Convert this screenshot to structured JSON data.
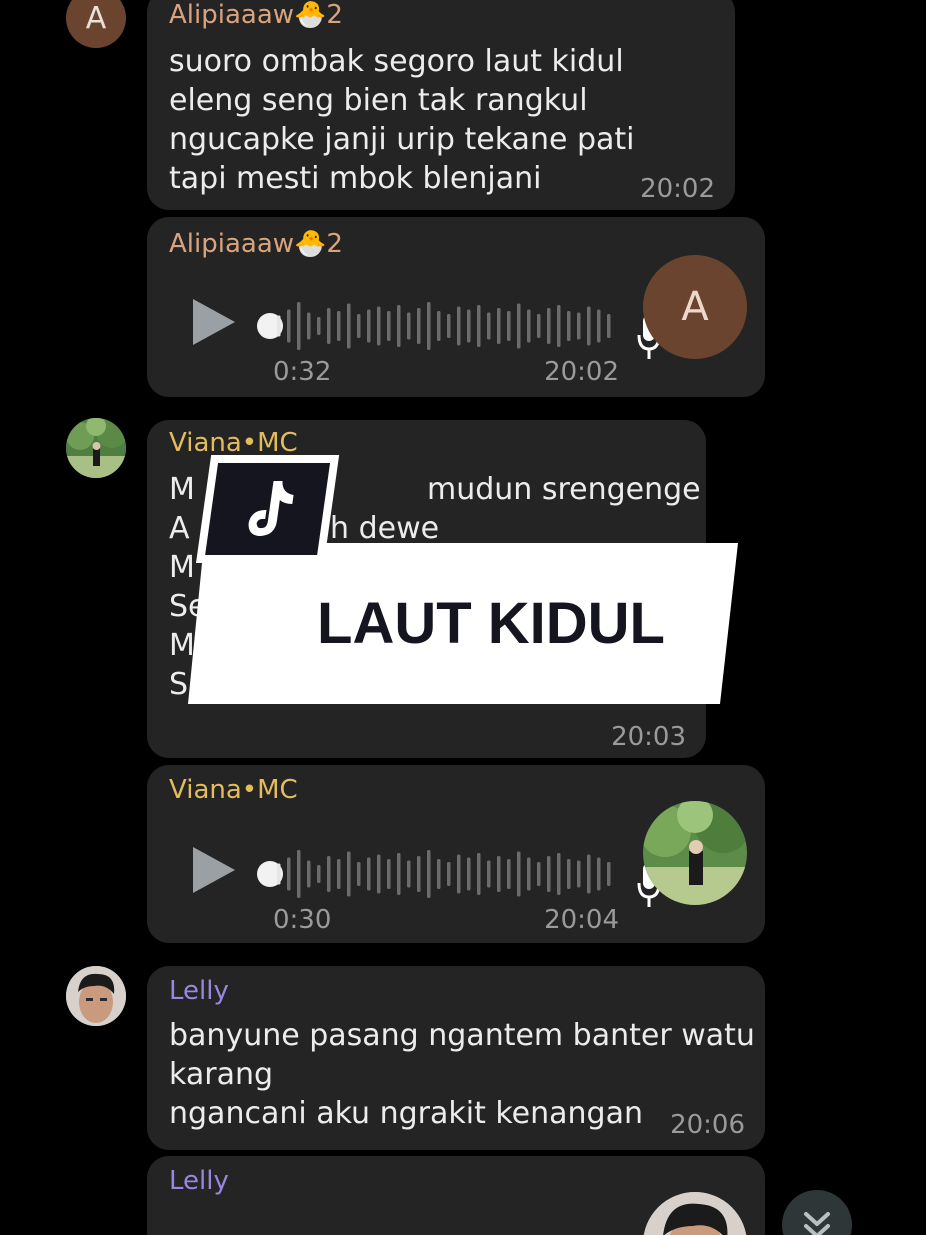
{
  "colors": {
    "background": "#000000",
    "bubble": "#242424",
    "sender_alipia": "#d9a37e",
    "sender_viana": "#e3bc5c",
    "sender_lelly": "#9a86df",
    "timestamp": "#9a9a9a",
    "message_text": "#ececec"
  },
  "messages": [
    {
      "type": "text",
      "avatar": "A",
      "sender": "Alipiaaaw🐣",
      "sender_badge": "2",
      "text": "suoro ombak segoro laut kidul\neleng seng bien tak rangkul\nngucapke janji urip tekane pati\ntapi mesti mbok blenjani",
      "time": "20:02"
    },
    {
      "type": "voice",
      "sender": "Alipiaaaw🐣",
      "sender_badge": "2",
      "avatar_large": "A",
      "duration": "0:32",
      "time": "20:02",
      "icons": [
        "play-icon",
        "microphone-icon"
      ]
    },
    {
      "type": "text",
      "sender": "Viana•MC",
      "line1_visible": "mudun srengenge",
      "line2_visible": "uh dewe",
      "line1_left": "M",
      "line2_left": "A",
      "line3_left": "M",
      "line4_left": "Se",
      "line5_left": "M",
      "line6_left": "S",
      "time": "20:03"
    },
    {
      "type": "voice",
      "sender": "Viana•MC",
      "duration": "0:30",
      "time": "20:04"
    },
    {
      "type": "text",
      "sender": "Lelly",
      "text": "banyune pasang ngantem banter watu\nkarang\nngancani aku ngrakit kenangan",
      "time": "20:06"
    },
    {
      "type": "voice",
      "sender": "Lelly"
    }
  ],
  "overlay": {
    "title": "LAUT KIDUL",
    "logo_icon": "tiktok-logo-icon"
  },
  "controls": {
    "scroll_down_icon": "double-chevron-down-icon"
  }
}
